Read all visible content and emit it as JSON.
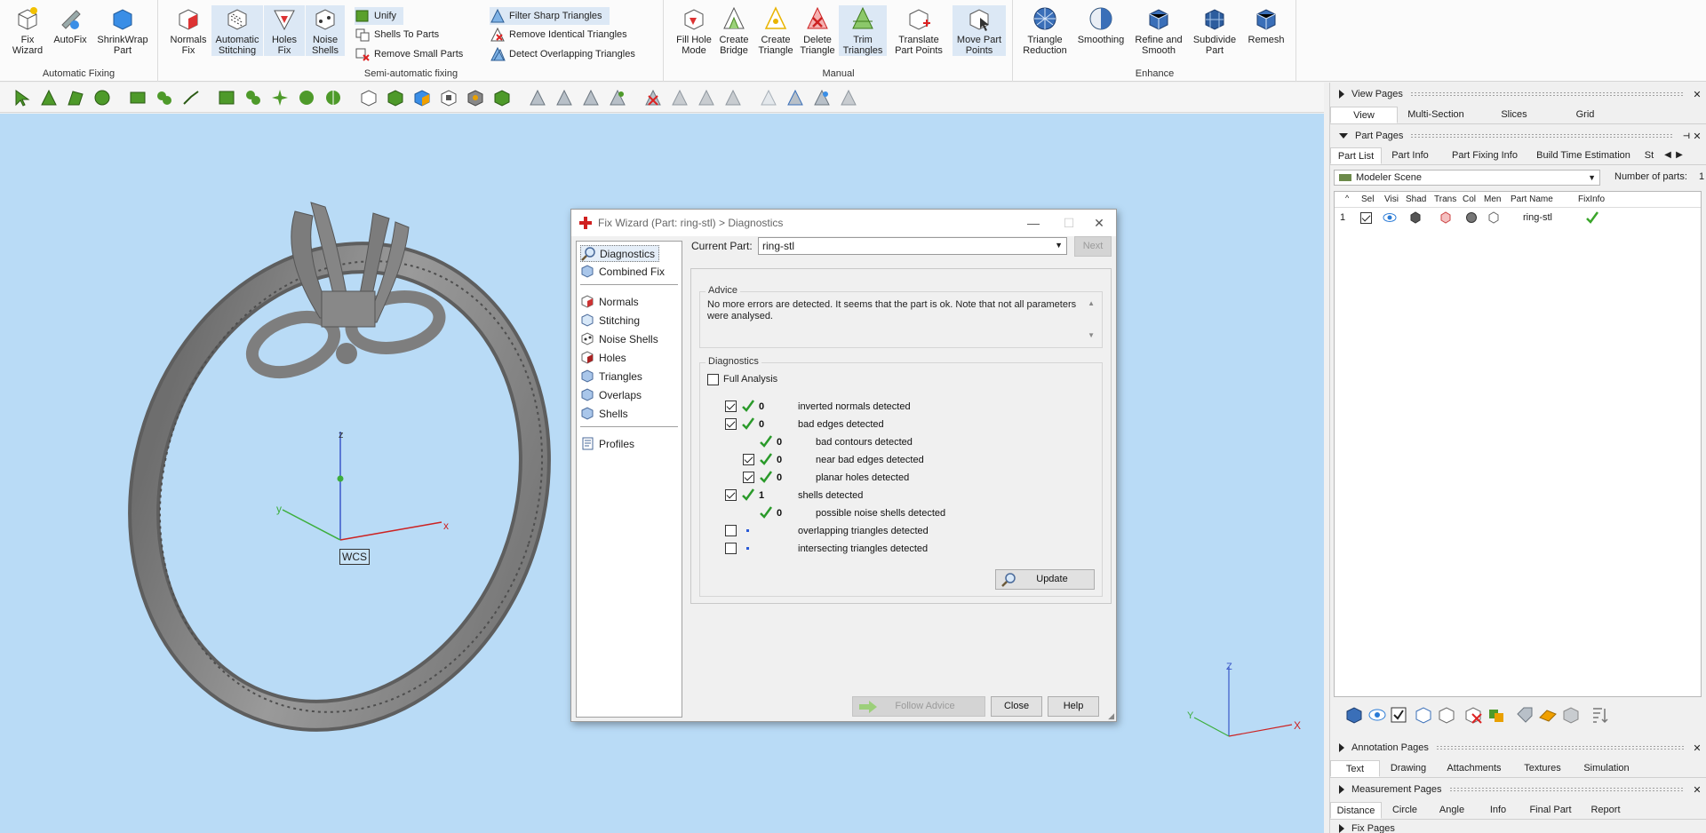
{
  "ribbon": {
    "groups": {
      "automatic": {
        "label": "Automatic Fixing",
        "buttons": [
          "Fix\nWizard",
          "AutoFix",
          "ShrinkWrap\nPart"
        ]
      },
      "semi": {
        "label": "Semi-automatic fixing",
        "buttons": [
          "Normals\nFix",
          "Automatic\nStitching",
          "Holes\nFix",
          "Noise\nShells"
        ],
        "small": [
          "Unify",
          "Shells To Parts",
          "Remove Small Parts"
        ],
        "triangles": [
          "Filter Sharp Triangles",
          "Remove Identical Triangles",
          "Detect Overlapping Triangles"
        ]
      },
      "manual": {
        "label": "Manual",
        "buttons": [
          "Fill Hole\nMode",
          "Create\nBridge",
          "Create\nTriangle",
          "Delete\nTriangle",
          "Trim\nTriangles",
          "Translate\nPart Points",
          "Move Part\nPoints"
        ]
      },
      "enhance": {
        "label": "Enhance",
        "buttons": [
          "Triangle\nReduction",
          "Smoothing",
          "Refine and\nSmooth",
          "Subdivide\nPart",
          "Remesh"
        ]
      }
    }
  },
  "viewport": {
    "wcs_label": "WCS",
    "axis_x": "x",
    "axis_y": "y",
    "axis_z": "z",
    "mini_x": "X",
    "mini_y": "Y",
    "mini_z": "Z"
  },
  "dialog": {
    "title": "Fix Wizard (Part: ring-stl) > Diagnostics",
    "nav": [
      "Diagnostics",
      "Combined Fix",
      "Normals",
      "Stitching",
      "Noise Shells",
      "Holes",
      "Triangles",
      "Overlaps",
      "Shells",
      "Profiles"
    ],
    "current_part_label": "Current Part:",
    "current_part_value": "ring-stl",
    "next_label": "Next",
    "advice_label": "Advice",
    "advice_text": "No more errors are detected. It seems that the part is ok. Note that not all parameters were analysed.",
    "diagnostics_label": "Diagnostics",
    "full_analysis_label": "Full Analysis",
    "rows": [
      {
        "count": "0",
        "text": "inverted normals detected"
      },
      {
        "count": "0",
        "text": "bad edges detected"
      },
      {
        "count": "0",
        "text": "bad contours detected"
      },
      {
        "count": "0",
        "text": "near bad edges detected"
      },
      {
        "count": "0",
        "text": "planar holes detected"
      },
      {
        "count": "1",
        "text": "shells detected"
      },
      {
        "count": "0",
        "text": "possible noise shells detected"
      },
      {
        "count": "",
        "text": "overlapping triangles detected"
      },
      {
        "count": "",
        "text": "intersecting triangles detected"
      }
    ],
    "update_label": "Update",
    "follow_advice_label": "Follow Advice",
    "close_label": "Close",
    "help_label": "Help"
  },
  "right_panel": {
    "view_pages": {
      "title": "View Pages",
      "tabs": [
        "View",
        "Multi-Section",
        "Slices",
        "Grid"
      ]
    },
    "part_pages": {
      "title": "Part Pages",
      "tabs": [
        "Part List",
        "Part Info",
        "Part Fixing Info",
        "Build Time Estimation",
        "St"
      ]
    },
    "scene": "Modeler Scene",
    "parts_count_label": "Number of parts:",
    "parts_count": "1",
    "columns": [
      "Sel",
      "Visi",
      "Shad",
      "Trans",
      "Col",
      "Men",
      "Part Name",
      "FixInfo"
    ],
    "row": {
      "index": "1",
      "name": "ring-stl"
    },
    "annotation_pages": {
      "title": "Annotation Pages",
      "tabs": [
        "Text",
        "Drawing",
        "Attachments",
        "Textures",
        "Simulation"
      ]
    },
    "measurement_pages": {
      "title": "Measurement Pages",
      "tabs": [
        "Distance",
        "Circle",
        "Angle",
        "Info",
        "Final Part",
        "Report"
      ]
    },
    "fix_pages": {
      "title": "Fix Pages"
    }
  }
}
